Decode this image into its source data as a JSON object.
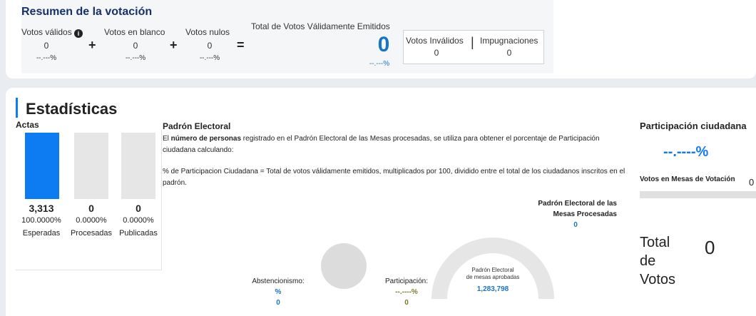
{
  "summary": {
    "title": "Resumen de la votación",
    "valid_label": "Votos válidos",
    "valid_value": "0",
    "valid_pct": "--.---%",
    "blank_label": "Votos en blanco",
    "blank_value": "0",
    "blank_pct": "--.---%",
    "null_label": "Votos nulos",
    "null_value": "0",
    "null_pct": "--.---%",
    "plus": "+",
    "equals": "=",
    "total_label": "Total de Votos Válidamente Emitidos",
    "total_value": "0",
    "total_pct": "--.---%",
    "invalid_label": "Votos Inválidos",
    "invalid_value": "0",
    "separator": "|",
    "challenges_label": "Impugnaciones",
    "challenges_value": "0"
  },
  "stats": {
    "title": "Estadísticas",
    "actas_label": "Actas",
    "bars": [
      {
        "fill": 1.0,
        "count": "3,313",
        "pct": "100.0000%",
        "label": "Esperadas"
      },
      {
        "fill": 0.0,
        "count": "0",
        "pct": "0.0000%",
        "label": "Procesadas"
      },
      {
        "fill": 0.0,
        "count": "0",
        "pct": "0.0000%",
        "label": "Publicadas"
      }
    ],
    "padron_title": "Padrón Electoral",
    "desc_pre": "El ",
    "desc_bold": "número de personas",
    "desc_post": " registrado en el Padrón Electoral de las Mesas procesadas, se utiliza para obtener el porcentaje de Participación ciudadana calculando:",
    "formula": "% de Participacion Ciudadana = Total de votos válidamente emitidos, multiplicados por 100, dividido entre el total de los ciudadanos inscritos en el padrón.",
    "padron_mesas_line1": "Padrón Electoral de las",
    "padron_mesas_line2": "Mesas Procesadas",
    "padron_mesas_value": "0",
    "abst_label": "Abstencionismo:",
    "abst_pct": "%",
    "abst_value": "0",
    "part_label": "Participación:",
    "part_pct": "--.----%",
    "part_value": "0",
    "gauge_line1": "Padrón Electoral",
    "gauge_line2": "de mesas aprobadas",
    "gauge_value": "1,283,798"
  },
  "right": {
    "title": "Participación ciudadana",
    "pct": "--.----%",
    "votes_label": "Votos en Mesas de Votación",
    "votes_value": "0",
    "total_line1": "Total",
    "total_line2": "de",
    "total_line3": "Votos",
    "total_value": "0"
  },
  "colors": {
    "accent": "#0d7cf2",
    "title": "#15306b",
    "link": "#1a74c4"
  }
}
